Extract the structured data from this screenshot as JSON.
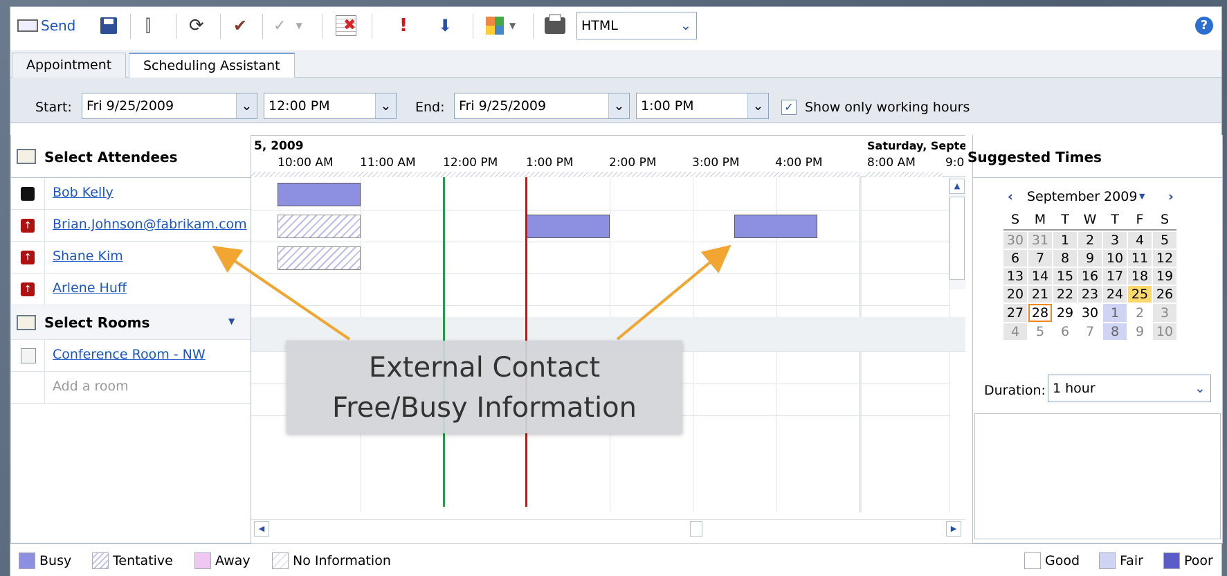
{
  "toolbar": {
    "send_label": "Send",
    "format_value": "HTML",
    "icons": [
      "send-icon",
      "save-icon",
      "attach-icon",
      "refresh-icon",
      "check-names-icon",
      "spelling-icon",
      "remove-icon",
      "high-importance-icon",
      "low-importance-icon",
      "categorize-icon",
      "print-icon",
      "help-icon"
    ]
  },
  "tabs": [
    {
      "label": "Appointment",
      "active": false
    },
    {
      "label": "Scheduling Assistant",
      "active": true
    }
  ],
  "timebar": {
    "start_label": "Start:",
    "start_date": "Fri 9/25/2009",
    "start_time": "12:00 PM",
    "end_label": "End:",
    "end_date": "Fri 9/25/2009",
    "end_time": "1:00 PM",
    "working_hours_label": "Show only working hours",
    "working_hours_checked": true
  },
  "attendees": {
    "header": "Select Attendees",
    "list": [
      {
        "name": "Bob Kelly",
        "type": "organizer"
      },
      {
        "name": "Brian.Johnson@fabrikam.com",
        "type": "required"
      },
      {
        "name": "Shane Kim",
        "type": "required"
      },
      {
        "name": "Arlene Huff",
        "type": "required"
      }
    ]
  },
  "rooms": {
    "header": "Select Rooms",
    "list": [
      {
        "name": "Conference Room - NW"
      }
    ],
    "add_placeholder": "Add a room"
  },
  "schedule": {
    "day1": "5, 2009",
    "day2": "Saturday, Septe",
    "times": [
      "10:00 AM",
      "11:00 AM",
      "12:00 PM",
      "1:00 PM",
      "2:00 PM",
      "3:00 PM",
      "4:00 PM",
      "8:00 AM",
      "9:0("
    ]
  },
  "callout": {
    "line1": "External Contact",
    "line2": "Free/Busy Information"
  },
  "suggested": {
    "header": "Suggested Times",
    "month": "September 2009",
    "weekdays": [
      "S",
      "M",
      "T",
      "W",
      "T",
      "F",
      "S"
    ],
    "weeks": [
      [
        "30",
        "31",
        "1",
        "2",
        "3",
        "4",
        "5"
      ],
      [
        "6",
        "7",
        "8",
        "9",
        "10",
        "11",
        "12"
      ],
      [
        "13",
        "14",
        "15",
        "16",
        "17",
        "18",
        "19"
      ],
      [
        "20",
        "21",
        "22",
        "23",
        "24",
        "25",
        "26"
      ],
      [
        "27",
        "28",
        "29",
        "30",
        "1",
        "2",
        "3"
      ],
      [
        "4",
        "5",
        "6",
        "7",
        "8",
        "9",
        "10"
      ]
    ],
    "selected_day": "25",
    "today": "28",
    "duration_label": "Duration:",
    "duration_value": "1 hour"
  },
  "legend": {
    "busy": "Busy",
    "tentative": "Tentative",
    "away": "Away",
    "no_info": "No Information",
    "good": "Good",
    "fair": "Fair",
    "poor": "Poor"
  },
  "colors": {
    "busy": "#8d8fe0",
    "away": "#f0c6f3",
    "fair": "#cfd3f4",
    "poor": "#5a5cc8",
    "current_line": "#cc1111",
    "now_line": "#2a9a4a",
    "arrow": "#f2a530"
  }
}
